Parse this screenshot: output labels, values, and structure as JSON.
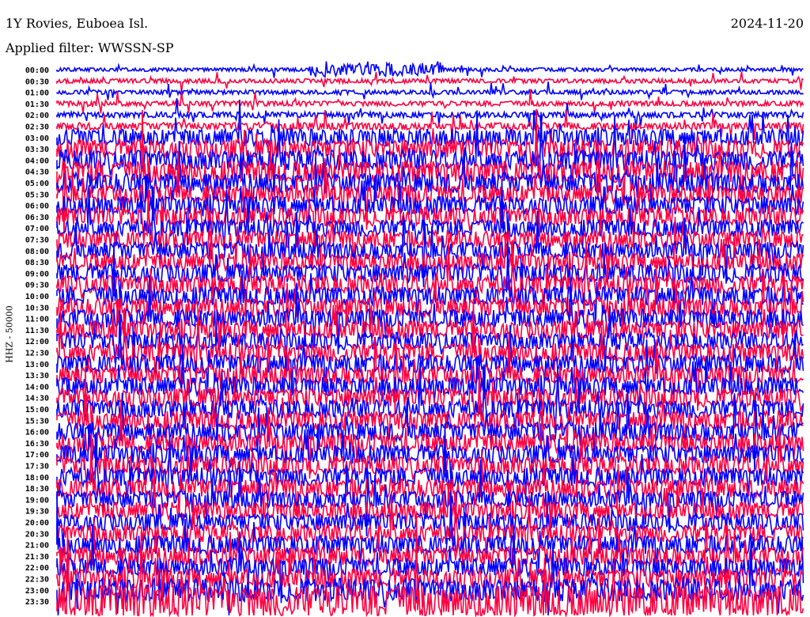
{
  "header": {
    "station": "1Y Rovies, Euboea Isl.",
    "filter": "Applied filter: WWSSN-SP",
    "date": "2024-11-20"
  },
  "chart_data": {
    "type": "line",
    "title": "1Y Rovies, Euboea Isl.",
    "ylabel": "HHZ - 50000",
    "row_labels": [
      "00:00",
      "00:30",
      "01:00",
      "01:30",
      "02:00",
      "02:30",
      "03:00",
      "03:30",
      "04:00",
      "04:30",
      "05:00",
      "05:30",
      "06:00",
      "06:30",
      "07:00",
      "07:30",
      "08:00",
      "08:30",
      "09:00",
      "09:30",
      "10:00",
      "10:30",
      "11:00",
      "11:30",
      "12:00",
      "12:30",
      "13:00",
      "13:30",
      "14:00",
      "14:30",
      "15:00",
      "15:30",
      "16:00",
      "16:30",
      "17:00",
      "17:30",
      "18:00",
      "18:30",
      "19:00",
      "19:30",
      "20:00",
      "20:30",
      "21:00",
      "21:30",
      "22:00",
      "22:30",
      "23:00",
      "23:30"
    ],
    "relative_amplitude": [
      0.25,
      0.3,
      0.3,
      0.35,
      0.4,
      0.5,
      1.2,
      1.3,
      1.4,
      1.5,
      1.4,
      1.3,
      1.3,
      1.3,
      1.2,
      1.2,
      1.2,
      1.2,
      1.3,
      1.3,
      1.3,
      1.3,
      1.3,
      1.3,
      1.2,
      1.3,
      1.3,
      1.3,
      1.3,
      1.3,
      1.3,
      1.3,
      1.3,
      1.3,
      1.3,
      1.3,
      1.3,
      1.3,
      1.2,
      1.2,
      1.2,
      1.2,
      1.3,
      1.3,
      1.3,
      1.4,
      1.6,
      2.2
    ],
    "series_colors": [
      "#0000ff",
      "#ff0040"
    ]
  }
}
